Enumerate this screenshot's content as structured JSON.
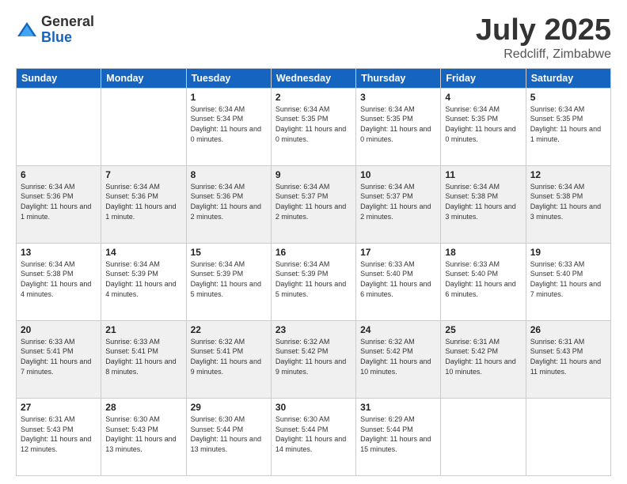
{
  "logo": {
    "general": "General",
    "blue": "Blue"
  },
  "title": "July 2025",
  "location": "Redcliff, Zimbabwe",
  "headers": [
    "Sunday",
    "Monday",
    "Tuesday",
    "Wednesday",
    "Thursday",
    "Friday",
    "Saturday"
  ],
  "weeks": [
    [
      {
        "day": "",
        "detail": ""
      },
      {
        "day": "",
        "detail": ""
      },
      {
        "day": "1",
        "detail": "Sunrise: 6:34 AM\nSunset: 5:34 PM\nDaylight: 11 hours and 0 minutes."
      },
      {
        "day": "2",
        "detail": "Sunrise: 6:34 AM\nSunset: 5:35 PM\nDaylight: 11 hours and 0 minutes."
      },
      {
        "day": "3",
        "detail": "Sunrise: 6:34 AM\nSunset: 5:35 PM\nDaylight: 11 hours and 0 minutes."
      },
      {
        "day": "4",
        "detail": "Sunrise: 6:34 AM\nSunset: 5:35 PM\nDaylight: 11 hours and 0 minutes."
      },
      {
        "day": "5",
        "detail": "Sunrise: 6:34 AM\nSunset: 5:35 PM\nDaylight: 11 hours and 1 minute."
      }
    ],
    [
      {
        "day": "6",
        "detail": "Sunrise: 6:34 AM\nSunset: 5:36 PM\nDaylight: 11 hours and 1 minute."
      },
      {
        "day": "7",
        "detail": "Sunrise: 6:34 AM\nSunset: 5:36 PM\nDaylight: 11 hours and 1 minute."
      },
      {
        "day": "8",
        "detail": "Sunrise: 6:34 AM\nSunset: 5:36 PM\nDaylight: 11 hours and 2 minutes."
      },
      {
        "day": "9",
        "detail": "Sunrise: 6:34 AM\nSunset: 5:37 PM\nDaylight: 11 hours and 2 minutes."
      },
      {
        "day": "10",
        "detail": "Sunrise: 6:34 AM\nSunset: 5:37 PM\nDaylight: 11 hours and 2 minutes."
      },
      {
        "day": "11",
        "detail": "Sunrise: 6:34 AM\nSunset: 5:38 PM\nDaylight: 11 hours and 3 minutes."
      },
      {
        "day": "12",
        "detail": "Sunrise: 6:34 AM\nSunset: 5:38 PM\nDaylight: 11 hours and 3 minutes."
      }
    ],
    [
      {
        "day": "13",
        "detail": "Sunrise: 6:34 AM\nSunset: 5:38 PM\nDaylight: 11 hours and 4 minutes."
      },
      {
        "day": "14",
        "detail": "Sunrise: 6:34 AM\nSunset: 5:39 PM\nDaylight: 11 hours and 4 minutes."
      },
      {
        "day": "15",
        "detail": "Sunrise: 6:34 AM\nSunset: 5:39 PM\nDaylight: 11 hours and 5 minutes."
      },
      {
        "day": "16",
        "detail": "Sunrise: 6:34 AM\nSunset: 5:39 PM\nDaylight: 11 hours and 5 minutes."
      },
      {
        "day": "17",
        "detail": "Sunrise: 6:33 AM\nSunset: 5:40 PM\nDaylight: 11 hours and 6 minutes."
      },
      {
        "day": "18",
        "detail": "Sunrise: 6:33 AM\nSunset: 5:40 PM\nDaylight: 11 hours and 6 minutes."
      },
      {
        "day": "19",
        "detail": "Sunrise: 6:33 AM\nSunset: 5:40 PM\nDaylight: 11 hours and 7 minutes."
      }
    ],
    [
      {
        "day": "20",
        "detail": "Sunrise: 6:33 AM\nSunset: 5:41 PM\nDaylight: 11 hours and 7 minutes."
      },
      {
        "day": "21",
        "detail": "Sunrise: 6:33 AM\nSunset: 5:41 PM\nDaylight: 11 hours and 8 minutes."
      },
      {
        "day": "22",
        "detail": "Sunrise: 6:32 AM\nSunset: 5:41 PM\nDaylight: 11 hours and 9 minutes."
      },
      {
        "day": "23",
        "detail": "Sunrise: 6:32 AM\nSunset: 5:42 PM\nDaylight: 11 hours and 9 minutes."
      },
      {
        "day": "24",
        "detail": "Sunrise: 6:32 AM\nSunset: 5:42 PM\nDaylight: 11 hours and 10 minutes."
      },
      {
        "day": "25",
        "detail": "Sunrise: 6:31 AM\nSunset: 5:42 PM\nDaylight: 11 hours and 10 minutes."
      },
      {
        "day": "26",
        "detail": "Sunrise: 6:31 AM\nSunset: 5:43 PM\nDaylight: 11 hours and 11 minutes."
      }
    ],
    [
      {
        "day": "27",
        "detail": "Sunrise: 6:31 AM\nSunset: 5:43 PM\nDaylight: 11 hours and 12 minutes."
      },
      {
        "day": "28",
        "detail": "Sunrise: 6:30 AM\nSunset: 5:43 PM\nDaylight: 11 hours and 13 minutes."
      },
      {
        "day": "29",
        "detail": "Sunrise: 6:30 AM\nSunset: 5:44 PM\nDaylight: 11 hours and 13 minutes."
      },
      {
        "day": "30",
        "detail": "Sunrise: 6:30 AM\nSunset: 5:44 PM\nDaylight: 11 hours and 14 minutes."
      },
      {
        "day": "31",
        "detail": "Sunrise: 6:29 AM\nSunset: 5:44 PM\nDaylight: 11 hours and 15 minutes."
      },
      {
        "day": "",
        "detail": ""
      },
      {
        "day": "",
        "detail": ""
      }
    ]
  ]
}
